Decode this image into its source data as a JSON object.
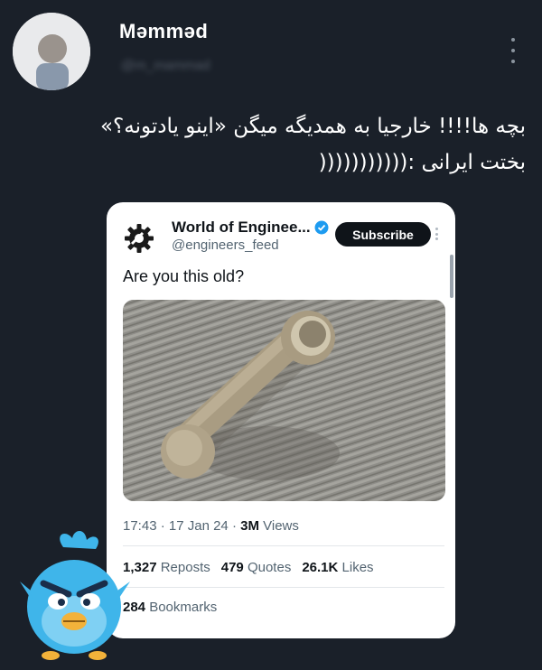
{
  "post": {
    "author_name": "Məmməd",
    "author_handle": "@m_mammad",
    "text_lines": [
      "بچه ها!!!! خارجیا به همدیگه میگن «اینو یادتونه؟»",
      "بختت ایرانی :((((((((((("
    ]
  },
  "quoted": {
    "account_name": "World of Enginee...",
    "account_handle": "@engineers_feed",
    "subscribe_label": "Subscribe",
    "text": "Are you this old?",
    "time": "17:43",
    "date": "17 Jan 24",
    "views_count": "3M",
    "views_label": "Views",
    "reposts_count": "1,327",
    "reposts_label": "Reposts",
    "quotes_count": "479",
    "quotes_label": "Quotes",
    "likes_count": "26.1K",
    "likes_label": "Likes",
    "bookmarks_count": "284",
    "bookmarks_label": "Bookmarks"
  },
  "icons": {
    "menu": "more-vertical-icon",
    "verified": "verified-badge-icon",
    "logo": "gear-logo-icon",
    "sticker": "angry-bird-sticker"
  },
  "colors": {
    "background": "#1a2029",
    "card": "#ffffff",
    "verified": "#1d9bf0",
    "bird": "#3fb5ea"
  }
}
